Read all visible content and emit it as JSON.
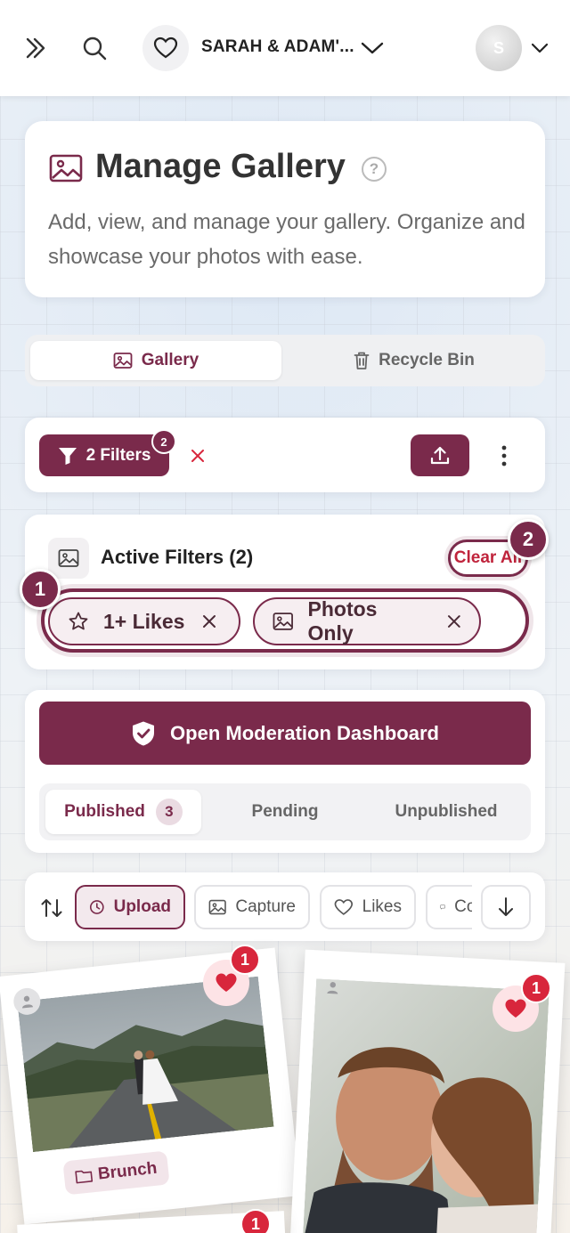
{
  "topbar": {
    "event_title": "SARAH & ADAM'...",
    "avatar_initial": "S"
  },
  "header": {
    "title": "Manage Gallery",
    "help": "?",
    "description": "Add, view, and manage your gallery. Organize and showcase your photos with ease."
  },
  "tabs": [
    {
      "label": "Gallery",
      "active": true
    },
    {
      "label": "Recycle Bin",
      "active": false
    }
  ],
  "filters": {
    "button_label": "2 Filters",
    "badge_count": "2"
  },
  "active_filters": {
    "title": "Active Filters (2)",
    "clear_all": "Clear All",
    "chips": [
      {
        "label": "1+ Likes",
        "icon": "star-icon"
      },
      {
        "label": "Photos Only",
        "icon": "image-icon"
      }
    ],
    "step_badges": [
      "1",
      "2"
    ]
  },
  "moderation": {
    "button_label": "Open Moderation Dashboard"
  },
  "status_tabs": [
    {
      "label": "Published",
      "count": "3",
      "active": true
    },
    {
      "label": "Pending",
      "active": false
    },
    {
      "label": "Unpublished",
      "active": false
    }
  ],
  "sort": {
    "options": [
      {
        "label": "Upload",
        "icon": "clock-icon",
        "active": true
      },
      {
        "label": "Capture",
        "icon": "image-icon",
        "active": false
      },
      {
        "label": "Likes",
        "icon": "heart-icon",
        "active": false
      },
      {
        "label": "Comments",
        "icon": "comment-icon",
        "active": false
      }
    ]
  },
  "photos": [
    {
      "tag": "Brunch",
      "likes": "1"
    },
    {
      "likes": "1"
    },
    {
      "likes": "1"
    }
  ],
  "colors": {
    "brand": "#7a2a4b",
    "like_red": "#d8263c"
  }
}
